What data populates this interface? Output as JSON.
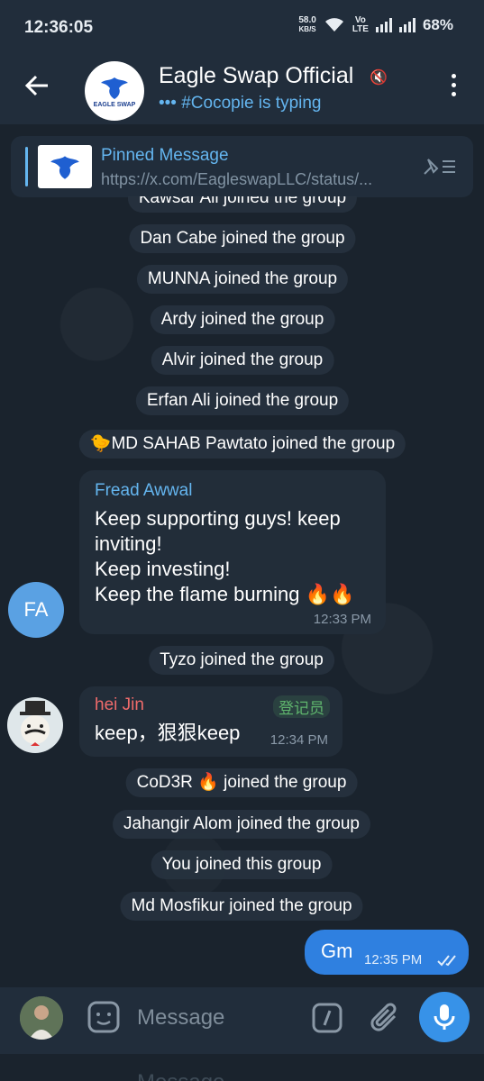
{
  "status_bar": {
    "time": "12:36:05",
    "net_speed_value": "58.0",
    "net_speed_unit": "KB/S",
    "network_label_top": "Vo",
    "network_label_bottom": "LTE",
    "battery": "68%"
  },
  "header": {
    "title": "Eagle Swap Official",
    "subtitle": "••• #Cocopie is typing",
    "logo_text": "EAGLE SWAP"
  },
  "pinned": {
    "title": "Pinned Message",
    "url": "https://x.com/EagleswapLLC/status/..."
  },
  "messages": {
    "svc_0": "Kawsar Ali joined the group",
    "svc_1": "Dan Cabe joined the group",
    "svc_2": "MUNNA joined the group",
    "svc_3": "Ardy joined the group",
    "svc_4": "Alvir joined the group",
    "svc_5": "Erfan Ali joined the group",
    "svc_6": "🐤MD SAHAB Pawtato joined the group",
    "fa": {
      "sender": "Fread Awwal",
      "initials": "FA",
      "text": "Keep supporting guys! keep\ninviting!\nKeep investing!\nKeep the flame burning 🔥🔥",
      "time": "12:33 PM"
    },
    "svc_7": "Tyzo joined the group",
    "jin": {
      "sender": "hei Jin",
      "badge": "登记员",
      "text": "keep，狠狠keep",
      "time": "12:34 PM"
    },
    "svc_8": "CoD3R 🔥 joined the group",
    "svc_9": "Jahangir Alom joined the group",
    "svc_10": "You joined this group",
    "svc_11": "Md Mosfikur joined the group",
    "out": {
      "text": "Gm",
      "time": "12:35 PM",
      "status": "read"
    }
  },
  "input": {
    "placeholder": "Message"
  },
  "colors": {
    "accent": "#64b5ef",
    "outgoing": "#2f80e0",
    "sender_fa": "#64b5ef",
    "sender_jin": "#ef6b6b",
    "badge": "#5fb56d"
  }
}
